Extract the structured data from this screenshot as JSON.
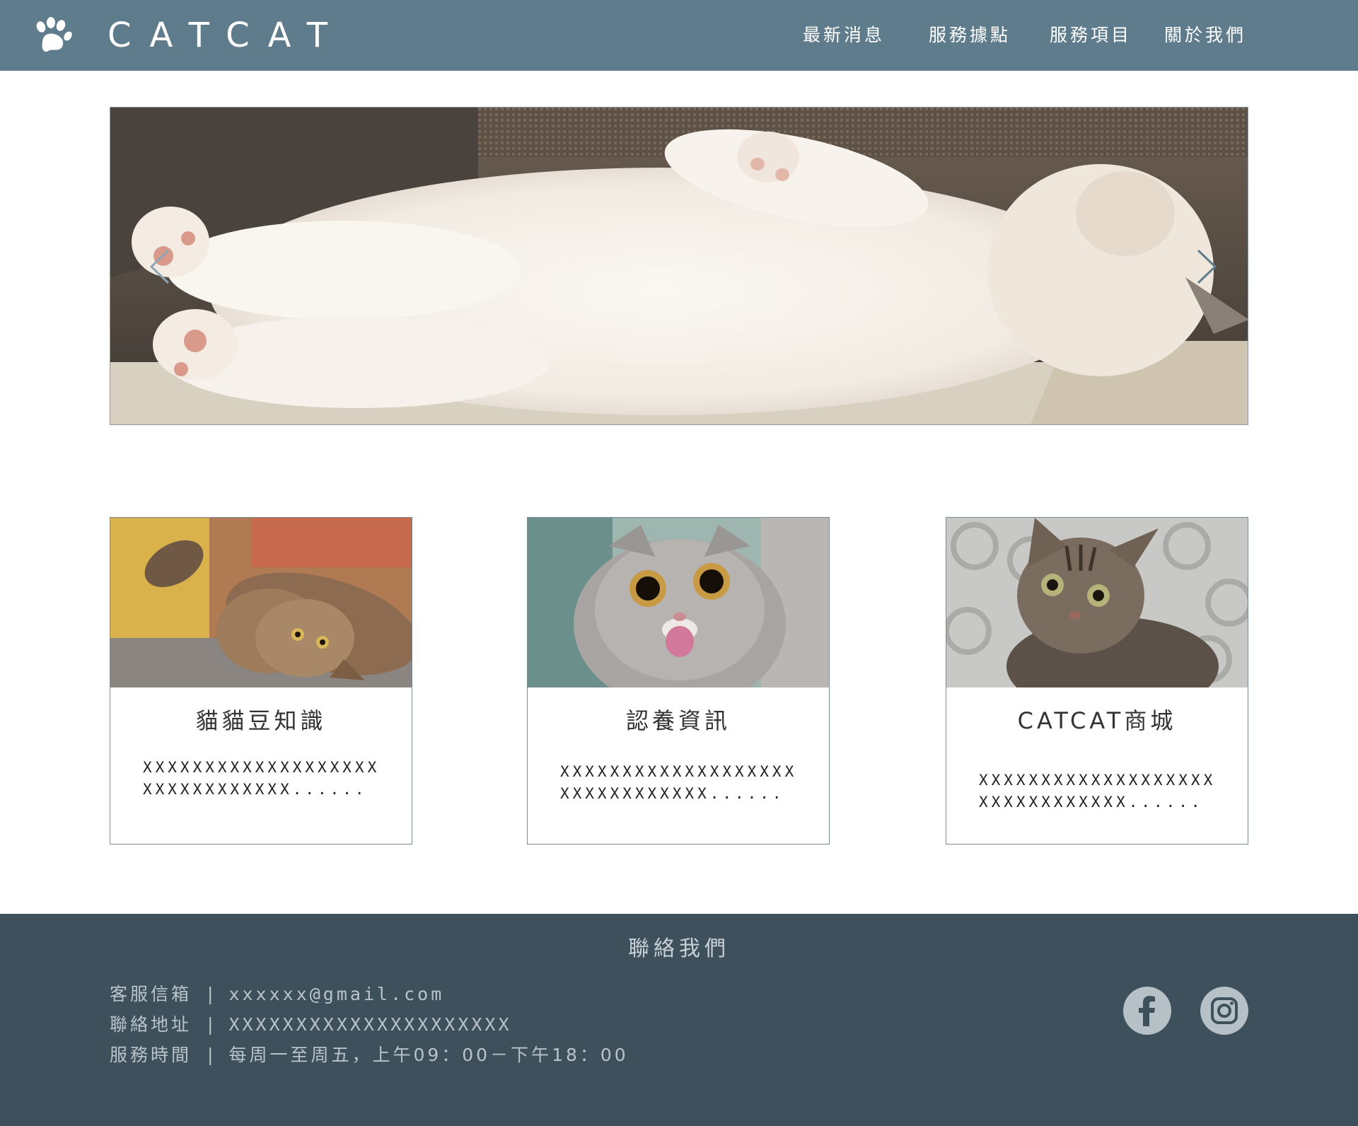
{
  "header": {
    "brand": "CATCAT",
    "logo_icon": "paw-print-icon",
    "nav": [
      "最新消息",
      "服務據點",
      "服務項目",
      "關於我們"
    ]
  },
  "hero": {
    "prev_icon": "chevron-left-icon",
    "next_icon": "chevron-right-icon"
  },
  "cards": [
    {
      "title": "貓貓豆知識",
      "text": "XXXXXXXXXXXXXXXXXXXXXXXXXXXXXXX......"
    },
    {
      "title": "認養資訊",
      "text": "XXXXXXXXXXXXXXXXXXXXXXXXXXXXXXX......"
    },
    {
      "title": "CATCAT商城",
      "text": "XXXXXXXXXXXXXXXXXXXXXXXXXXXXXXX......"
    }
  ],
  "footer": {
    "title": "聯絡我們",
    "email_label": "客服信箱",
    "email_value": "xxxxxx@gmail.com",
    "address_label": "聯絡地址",
    "address_value": "XXXXXXXXXXXXXXXXXXXXX",
    "hours_label": "服務時間",
    "hours_value": "每周一至周五，上午09：00－下午18：00",
    "separator": "|",
    "social": [
      "facebook-icon",
      "instagram-icon"
    ]
  },
  "colors": {
    "header_bg": "#5f7c8c",
    "footer_bg": "#3d505c",
    "card_border": "#7a8c98",
    "social_bg": "#b5c0c7"
  }
}
